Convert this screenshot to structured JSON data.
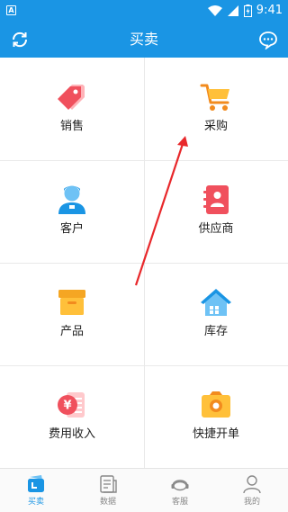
{
  "status_bar": {
    "time": "9:41"
  },
  "app_bar": {
    "title": "买卖",
    "left_icon": "refresh-icon",
    "right_icon": "message-icon"
  },
  "menu": [
    {
      "label": "销售",
      "icon": "sales-tag-icon"
    },
    {
      "label": "采购",
      "icon": "cart-icon"
    },
    {
      "label": "客户",
      "icon": "customer-icon"
    },
    {
      "label": "供应商",
      "icon": "supplier-icon"
    },
    {
      "label": "产品",
      "icon": "product-box-icon"
    },
    {
      "label": "库存",
      "icon": "warehouse-icon"
    },
    {
      "label": "费用收入",
      "icon": "expense-income-icon"
    },
    {
      "label": "快捷开单",
      "icon": "camera-icon"
    }
  ],
  "tabs": [
    {
      "label": "买卖",
      "icon": "trade-icon",
      "active": true
    },
    {
      "label": "数据",
      "icon": "data-icon",
      "active": false
    },
    {
      "label": "客服",
      "icon": "service-icon",
      "active": false
    },
    {
      "label": "我的",
      "icon": "profile-icon",
      "active": false
    }
  ],
  "colors": {
    "primary": "#1a95e4",
    "annotation_arrow": "#e8282b"
  }
}
